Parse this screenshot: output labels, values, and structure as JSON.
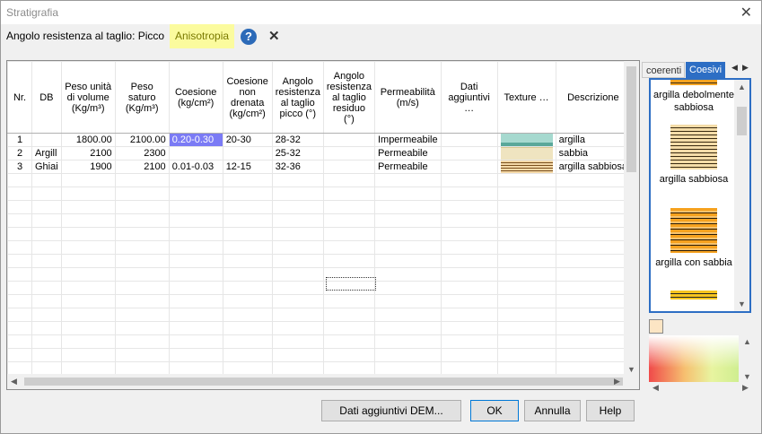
{
  "window": {
    "title": "Stratigrafia",
    "close": "✕"
  },
  "toolbar": {
    "mode_label": "Angolo resistenza al taglio: Picco",
    "anisotropia": "Anisotropia",
    "help": "?",
    "close": "✕"
  },
  "grid": {
    "headers": [
      "Nr.",
      "DB",
      "Peso unità di volume (Kg/m³)",
      "Peso saturo (Kg/m³)",
      "Coesione (kg/cm²)",
      "Coesione non drenata (kg/cm²)",
      "Angolo resistenza al taglio picco (°)",
      "Angolo resistenza al taglio residuo (°)",
      "Permeabilità (m/s)",
      "Dati aggiuntivi …",
      "Texture …",
      "Descrizione"
    ],
    "rows": [
      {
        "nr": "1",
        "db": "",
        "peso_vol": "1800.00",
        "peso_sat": "2100.00",
        "coesione": "0.20-0.30",
        "coes_nd": "20-30",
        "ang_picco": "28-32",
        "ang_res": "",
        "perm": "Impermeabile",
        "dati": "",
        "descr": "argilla"
      },
      {
        "nr": "2",
        "db": "Argill",
        "peso_vol": "2100",
        "peso_sat": "2300",
        "coesione": "",
        "coes_nd": "",
        "ang_picco": "25-32",
        "ang_res": "",
        "perm": "Permeabile",
        "dati": "",
        "descr": "sabbia"
      },
      {
        "nr": "3",
        "db": "Ghiai",
        "peso_vol": "1900",
        "peso_sat": "2100",
        "coesione": "0.01-0.03",
        "coes_nd": "12-15",
        "ang_picco": "32-36",
        "ang_res": "",
        "perm": "Permeabile",
        "dati": "",
        "descr": "argilla sabbiosa"
      }
    ]
  },
  "texture_panel": {
    "tab_inactive": "coerenti",
    "tab_active": "Coesivi",
    "items": [
      "argilla debolmente sabbiosa",
      "argilla sabbiosa",
      "argilla con sabbia"
    ]
  },
  "buttons": {
    "dem": "Dati aggiuntivi DEM...",
    "ok": "OK",
    "cancel": "Annulla",
    "help": "Help"
  }
}
